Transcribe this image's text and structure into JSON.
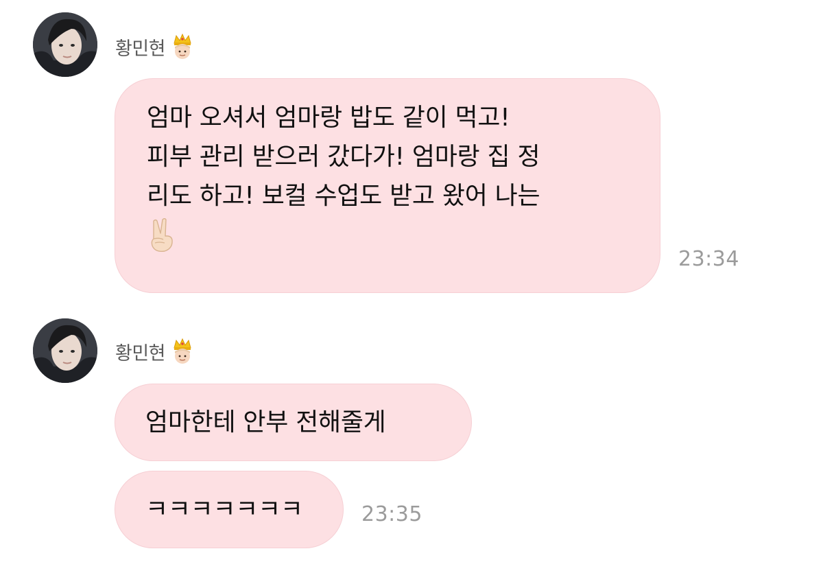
{
  "messages": [
    {
      "sender": "황민현",
      "badge_icon": "prince-crown-icon",
      "avatar": "profile-avatar",
      "lines": [
        "엄마 오셔서 엄마랑 밥도 같이 먹고!",
        "피부 관리 받으러 갔다가! 엄마랑 집 정",
        "리도 하고! 보컬 수업도 받고 왔어 나는"
      ],
      "emoji": "victory-hand-icon",
      "time": "23:34"
    },
    {
      "sender": "황민현",
      "badge_icon": "prince-crown-icon",
      "avatar": "profile-avatar",
      "text_1": "엄마한테 안부 전해줄게",
      "text_2": "ㅋㅋㅋㅋㅋㅋㅋ",
      "time": "23:35"
    }
  ],
  "colors": {
    "bubble_bg": "#fde0e3",
    "bubble_border": "#f6cfd4",
    "timestamp": "#9b9b9b",
    "sender_name": "#5a5a5a"
  }
}
